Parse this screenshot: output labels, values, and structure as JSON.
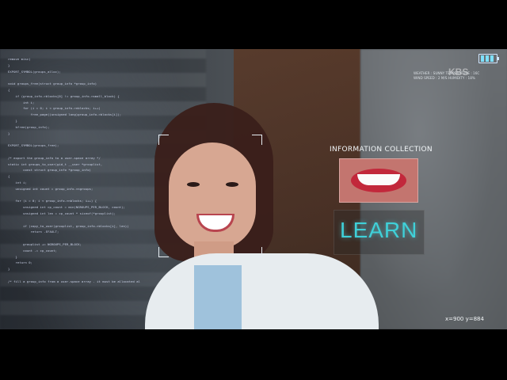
{
  "overlay": {
    "logo": "KBS",
    "weather_line1": "WEATHER : SUNNY   TEMPERATURE : 16C",
    "weather_line2": "WIND SPEED : 2 M/S   HUMIDITY : 18%",
    "info_title": "INFORMATION COLLECTION",
    "learn_label": "LEARN",
    "coords_text": "x=900 y=884",
    "battery_bars": 3
  },
  "code_lines": [
    "remove misc)",
    "}",
    "EXPORT_SYMBOL(groups_alloc);",
    "",
    "void groups_free(struct group_info *group_info)",
    "{",
    "    if (group_info->blocks[0] != group_info->small_block) {",
    "        int i;",
    "        for (i = 0; i < group_info->nblocks; i++)",
    "            free_page((unsigned long)group_info->blocks[i]);",
    "    }",
    "    kfree(group_info);",
    "}",
    "",
    "EXPORT_SYMBOL(groups_free);",
    "",
    "/* export the group_info to a user-space array */",
    "static int groups_to_user(gid_t __user *grouplist,",
    "        const struct group_info *group_info)",
    "{",
    "    int i;",
    "    unsigned int count = group_info->ngroups;",
    "",
    "    for (i = 0; i < group_info->nblocks; i++) {",
    "        unsigned int cp_count = min(NGROUPS_PER_BLOCK, count);",
    "        unsigned int len = cp_count * sizeof(*grouplist);",
    "",
    "        if (copy_to_user(grouplist, group_info->blocks[i], len))",
    "            return -EFAULT;",
    "",
    "        grouplist += NGROUPS_PER_BLOCK;",
    "        count -= cp_count;",
    "    }",
    "    return 0;",
    "}",
    "",
    "/* fill a group_info from a user-space array - it must be allocated al"
  ],
  "colors": {
    "hud_text": "#f1f5f7",
    "learn_cyan": "#3fd0d8",
    "code_text": "#dfe7ff"
  }
}
